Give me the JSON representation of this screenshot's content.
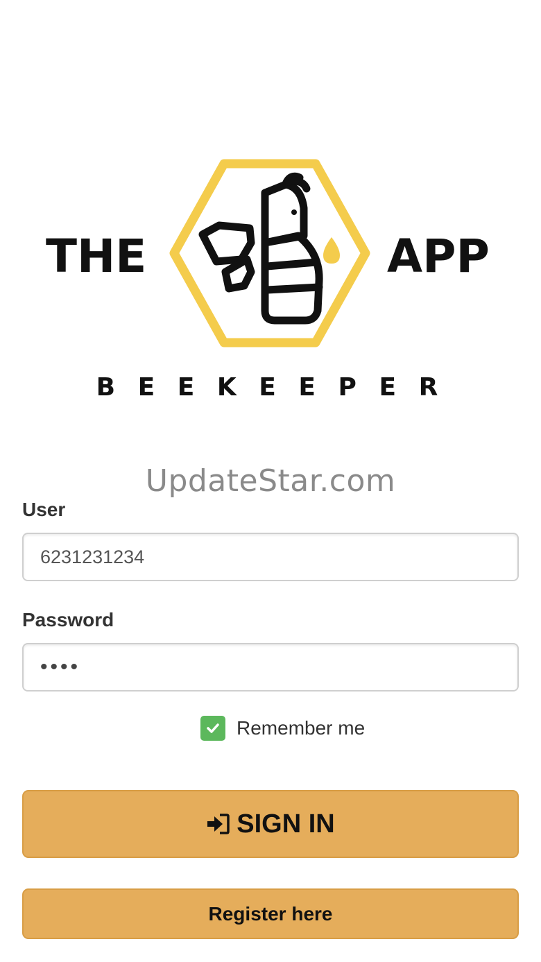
{
  "logo": {
    "left_text": "THE",
    "right_text": "APP",
    "subtitle": "B E E K E E P E R",
    "icon": "bee-hexagon-icon",
    "accent_color": "#f4cc4c"
  },
  "watermark": "UpdateStar.com",
  "form": {
    "user_label": "User",
    "user_value": "6231231234",
    "password_label": "Password",
    "password_value": "••••",
    "remember_label": "Remember me",
    "remember_checked": true
  },
  "buttons": {
    "sign_in_label": "SIGN IN",
    "sign_in_icon": "sign-in-icon",
    "register_label": "Register here",
    "button_color": "#e5ad5b"
  },
  "colors": {
    "checkbox": "#5cb85c"
  }
}
